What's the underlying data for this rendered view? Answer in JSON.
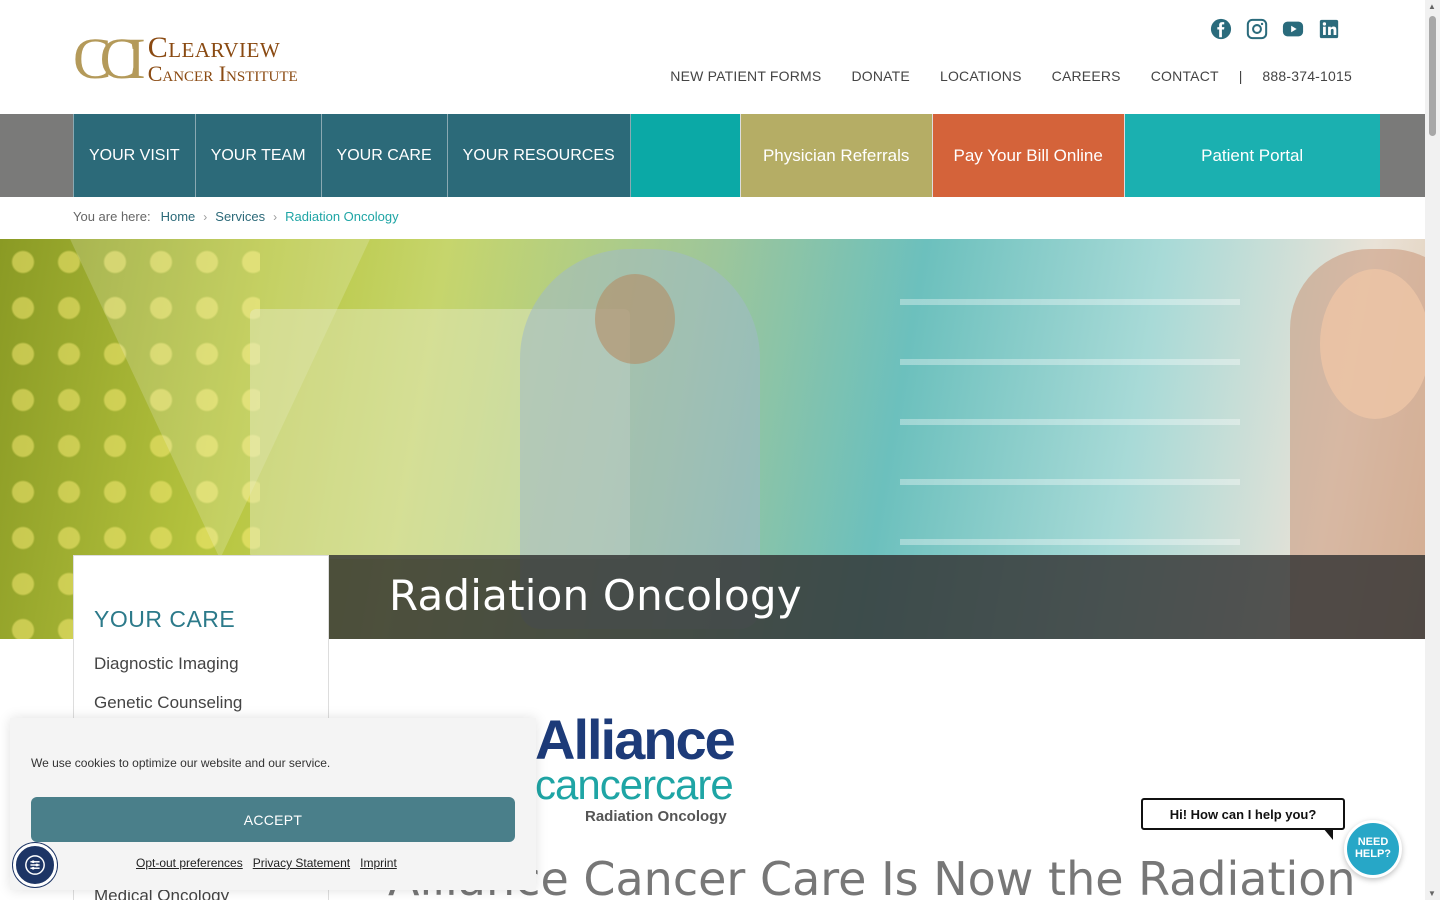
{
  "brand": {
    "mark": "CCI",
    "name_line1": "Clearview",
    "name_line2": "Cancer Institute"
  },
  "social": [
    "facebook-icon",
    "instagram-icon",
    "youtube-icon",
    "linkedin-icon"
  ],
  "utility_nav": {
    "items": [
      "NEW PATIENT FORMS",
      "DONATE",
      "LOCATIONS",
      "CAREERS",
      "CONTACT"
    ],
    "separator": "|",
    "phone": "888-374-1015"
  },
  "main_nav": {
    "items": [
      "YOUR VISIT",
      "YOUR TEAM",
      "YOUR CARE",
      "YOUR RESOURCES"
    ],
    "buttons": [
      "Physician Referrals",
      "Pay Your Bill Online",
      "Patient Portal"
    ]
  },
  "breadcrumb": {
    "prefix": "You are here:",
    "items": [
      "Home",
      "Services"
    ],
    "current": "Radiation Oncology"
  },
  "hero": {
    "title": "Radiation Oncology"
  },
  "sidebar": {
    "heading": "YOUR CARE",
    "items": [
      "Diagnostic Imaging",
      "Genetic Counseling",
      "Medical Oncology"
    ]
  },
  "partner": {
    "line1": "Alliance",
    "line2": "cancercare",
    "line3": "Radiation Oncology"
  },
  "content": {
    "heading": "Alliance Cancer Care Is Now the Radiation"
  },
  "cookie": {
    "message": "We use cookies to optimize our website and our service.",
    "accept": "ACCEPT",
    "links": [
      "Opt-out preferences",
      "Privacy Statement",
      "Imprint"
    ]
  },
  "chat": {
    "bubble": "Hi! How can I help you?",
    "button": "NEED HELP?"
  },
  "colors": {
    "nav_dark": "#2c6a79",
    "nav_teal": "#0ba9a6",
    "referrals": "#b5ad65",
    "pay": "#d4633a",
    "portal": "#1bb0b0",
    "brand_brown": "#8a4a12"
  }
}
